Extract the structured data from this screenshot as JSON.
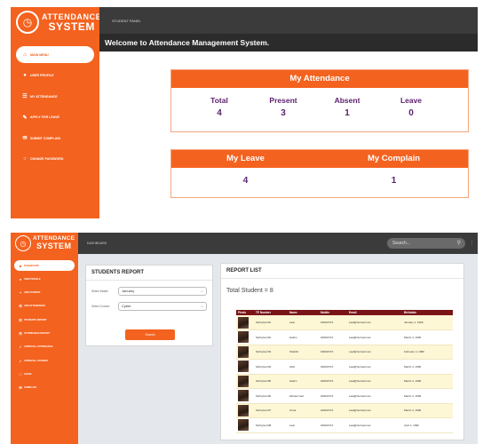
{
  "top": {
    "logo": {
      "line1": "ATTENDANCE",
      "line2": "SYSTEM"
    },
    "header_title": "STUDENT PANEL",
    "welcome": "Welcome to Attendance Management System.",
    "nav": [
      {
        "label": "MAIN MENU",
        "icon": "home-icon",
        "active": true
      },
      {
        "label": "USER PROFILE",
        "icon": "user-icon"
      },
      {
        "label": "MY ATTENDANCE",
        "icon": "list-icon"
      },
      {
        "label": "APPLY FOR LEAVE",
        "icon": "edit-icon"
      },
      {
        "label": "SUBMIT COMPLAIN",
        "icon": "message-icon"
      },
      {
        "label": "CHANGE PASSWORD",
        "icon": "lock-icon"
      }
    ],
    "attendance": {
      "title": "My Attendance",
      "stats": [
        {
          "label": "Total",
          "value": "4"
        },
        {
          "label": "Present",
          "value": "3"
        },
        {
          "label": "Absent",
          "value": "1"
        },
        {
          "label": "Leave",
          "value": "0"
        }
      ]
    },
    "leave_card": {
      "leave_label": "My Leave",
      "leave_value": "4",
      "complain_label": "My Complain",
      "complain_value": "1"
    }
  },
  "bottom": {
    "logo": {
      "line1": "ATTENDANCE",
      "line2": "SYSTEM"
    },
    "header_title": "DASHBOARD",
    "search_placeholder": "Search...",
    "nav": [
      {
        "label": "DASHBOARD",
        "active": true
      },
      {
        "label": "VIEW PROFILE"
      },
      {
        "label": "ADD STUDENT"
      },
      {
        "label": "ADD ATTENDANCE"
      },
      {
        "label": "STUDENTS REPORT"
      },
      {
        "label": "ATTENDANCE REPORT"
      },
      {
        "label": "APPROVAL ATTENDANCE"
      },
      {
        "label": "APPROVAL STUDENT"
      },
      {
        "label": "LEAVE"
      },
      {
        "label": "COMPLAIN"
      }
    ],
    "students_report": {
      "title": "STUDENTS REPORT",
      "field1_label": "Select Intake:",
      "field1_value": "January",
      "field2_label": "Select Course:",
      "field2_value": "Cyber",
      "button": "Search"
    },
    "report_list": {
      "title": "REPORT LIST",
      "total": "Total Student = 8",
      "columns": [
        "Photo",
        "TP Number",
        "Name",
        "Mobile",
        "Email",
        "Birthdate"
      ],
      "rows": [
        [
          "",
          "SH/Cyber/01",
          "Laal",
          "01822XXX",
          "Laal@hotmail.com",
          "January 1, 1999"
        ],
        [
          "",
          "SH/Cyber/02",
          "Hakim",
          "01822XXX",
          "Laal@hotmail.com",
          "March 4, 1996"
        ],
        [
          "",
          "SH/Cyber/03",
          "Shabbir",
          "01822XXX",
          "Laal@hotmail.com",
          "February 4, 1996"
        ],
        [
          "",
          "SH/Cyber/04",
          "Abid",
          "01822XXX",
          "Laal@hotmail.com",
          "March 4, 1996"
        ],
        [
          "",
          "SH/Cyber/05",
          "Hakim",
          "01822XXX",
          "Laal@hotmail.com",
          "March 4, 1996"
        ],
        [
          "",
          "SH/Cyber/06",
          "Mohammad",
          "01822XXX",
          "Laal@hotmail.com",
          "March 4, 1996"
        ],
        [
          "",
          "SH/Cyber/07",
          "Omar",
          "01822XXX",
          "Laal@hotmail.com",
          "March 4, 1996"
        ],
        [
          "",
          "SH/Cyber/08",
          "Laal",
          "01822XXX",
          "Laal@hotmail.com",
          "April 1, 1996"
        ]
      ]
    }
  },
  "colors": {
    "accent": "#f4621f",
    "dark": "#3b3b3b",
    "value_text": "#5c1f6e",
    "table_header": "#7a1418",
    "row_highlight": "#fdf7d6"
  }
}
